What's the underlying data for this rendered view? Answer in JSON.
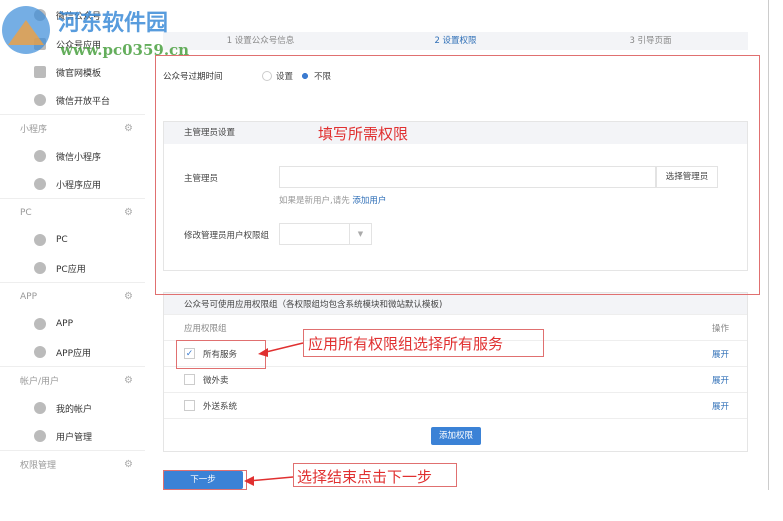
{
  "watermark": {
    "title": "河东软件园",
    "url": "www.pc0359.cn"
  },
  "sidebar": {
    "top_items": [
      {
        "label": "微信公众号"
      },
      {
        "label": "公众号应用"
      },
      {
        "label": "微官网模板"
      },
      {
        "label": "微信开放平台"
      }
    ],
    "sections": [
      {
        "title": "小程序",
        "items": [
          "微信小程序",
          "小程序应用"
        ]
      },
      {
        "title": "PC",
        "items": [
          "PC",
          "PC应用"
        ]
      },
      {
        "title": "APP",
        "items": [
          "APP",
          "APP应用"
        ]
      },
      {
        "title": "帐户/用户",
        "items": [
          "我的帐户",
          "用户管理"
        ]
      },
      {
        "title": "权限管理",
        "items": []
      }
    ]
  },
  "steps": [
    "1 设置公众号信息",
    "2 设置权限",
    "3 引导页面"
  ],
  "expire": {
    "label": "公众号过期时间",
    "opt1": "设置",
    "opt2": "不限"
  },
  "admin": {
    "header": "主管理员设置",
    "label": "主管理员",
    "select_btn": "选择管理员",
    "hint": "如果是新用户,请先",
    "hint_link": "添加用户",
    "group_label": "修改管理员用户权限组"
  },
  "perm": {
    "header": "公众号可使用应用权限组（各权限组均包含系统模块和微站默认模板)",
    "col1": "应用权限组",
    "col2": "操作",
    "rows": [
      {
        "name": "所有服务",
        "checked": true,
        "op": "展开"
      },
      {
        "name": "微外卖",
        "checked": false,
        "op": "展开"
      },
      {
        "name": "外送系统",
        "checked": false,
        "op": "展开"
      }
    ],
    "add_btn": "添加权限"
  },
  "next_btn": "下一步",
  "annotations": {
    "a1": "填写所需权限",
    "a2": "应用所有权限组选择所有服务",
    "a3": "选择结束点击下一步"
  }
}
